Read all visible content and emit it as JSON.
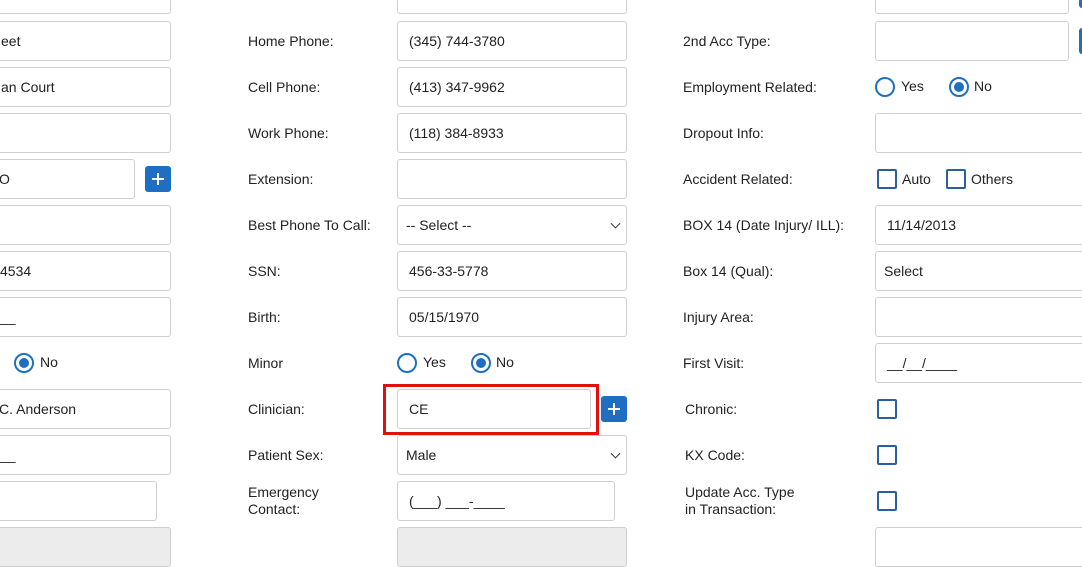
{
  "col1": {
    "street": "eet",
    "address2": "an Court",
    "city": "",
    "state": "O",
    "zip": "",
    "phone": "4534",
    "date": "__",
    "radio_no_label": "No",
    "provider": "C. Anderson",
    "field10": "__",
    "field11": ""
  },
  "col2": {
    "labels": {
      "home_phone": "Home Phone:",
      "cell_phone": "Cell Phone:",
      "work_phone": "Work Phone:",
      "extension": "Extension:",
      "best_phone": "Best Phone To Call:",
      "ssn": "SSN:",
      "birth": "Birth:",
      "minor": "Minor",
      "clinician": "Clinician:",
      "patient_sex": "Patient Sex:",
      "emergency_1": "Emergency",
      "emergency_2": "Contact:"
    },
    "values": {
      "home_phone": "(345) 744-3780",
      "cell_phone": "(413) 347-9962",
      "work_phone": "(118) 384-8933",
      "extension": "",
      "best_phone": "-- Select --",
      "ssn": "456-33-5778",
      "birth": "05/15/1970",
      "minor_yes": "Yes",
      "minor_no": "No",
      "minor_selected": "No",
      "clinician": "CE",
      "patient_sex": "Male",
      "emergency_contact": "(___) ___-____"
    }
  },
  "col3": {
    "labels": {
      "second_acc_type": "2nd Acc Type:",
      "employment_related": "Employment Related:",
      "dropout_info": "Dropout Info:",
      "accident_related": "Accident Related:",
      "box14_date": "BOX 14 (Date Injury/ ILL):",
      "box14_qual": "Box 14 (Qual):",
      "injury_area": "Injury Area:",
      "first_visit": "First Visit:",
      "chronic": "Chronic:",
      "kx_code": "KX Code:",
      "update_acc_1": "Update Acc. Type",
      "update_acc_2": "in Transaction:"
    },
    "values": {
      "second_acc_type": "",
      "employment_yes": "Yes",
      "employment_no": "No",
      "employment_selected": "No",
      "dropout_info": "",
      "accident_auto": "Auto",
      "accident_others": "Others",
      "box14_date": "11/14/2013",
      "box14_qual": "Select",
      "injury_area": "",
      "first_visit": "__/__/____",
      "chronic_checked": false,
      "kx_code_checked": false,
      "update_acc_checked": false
    }
  },
  "colors": {
    "accent": "#1e6fc3",
    "highlight": "#e01010",
    "border": "#cfcfcf"
  }
}
